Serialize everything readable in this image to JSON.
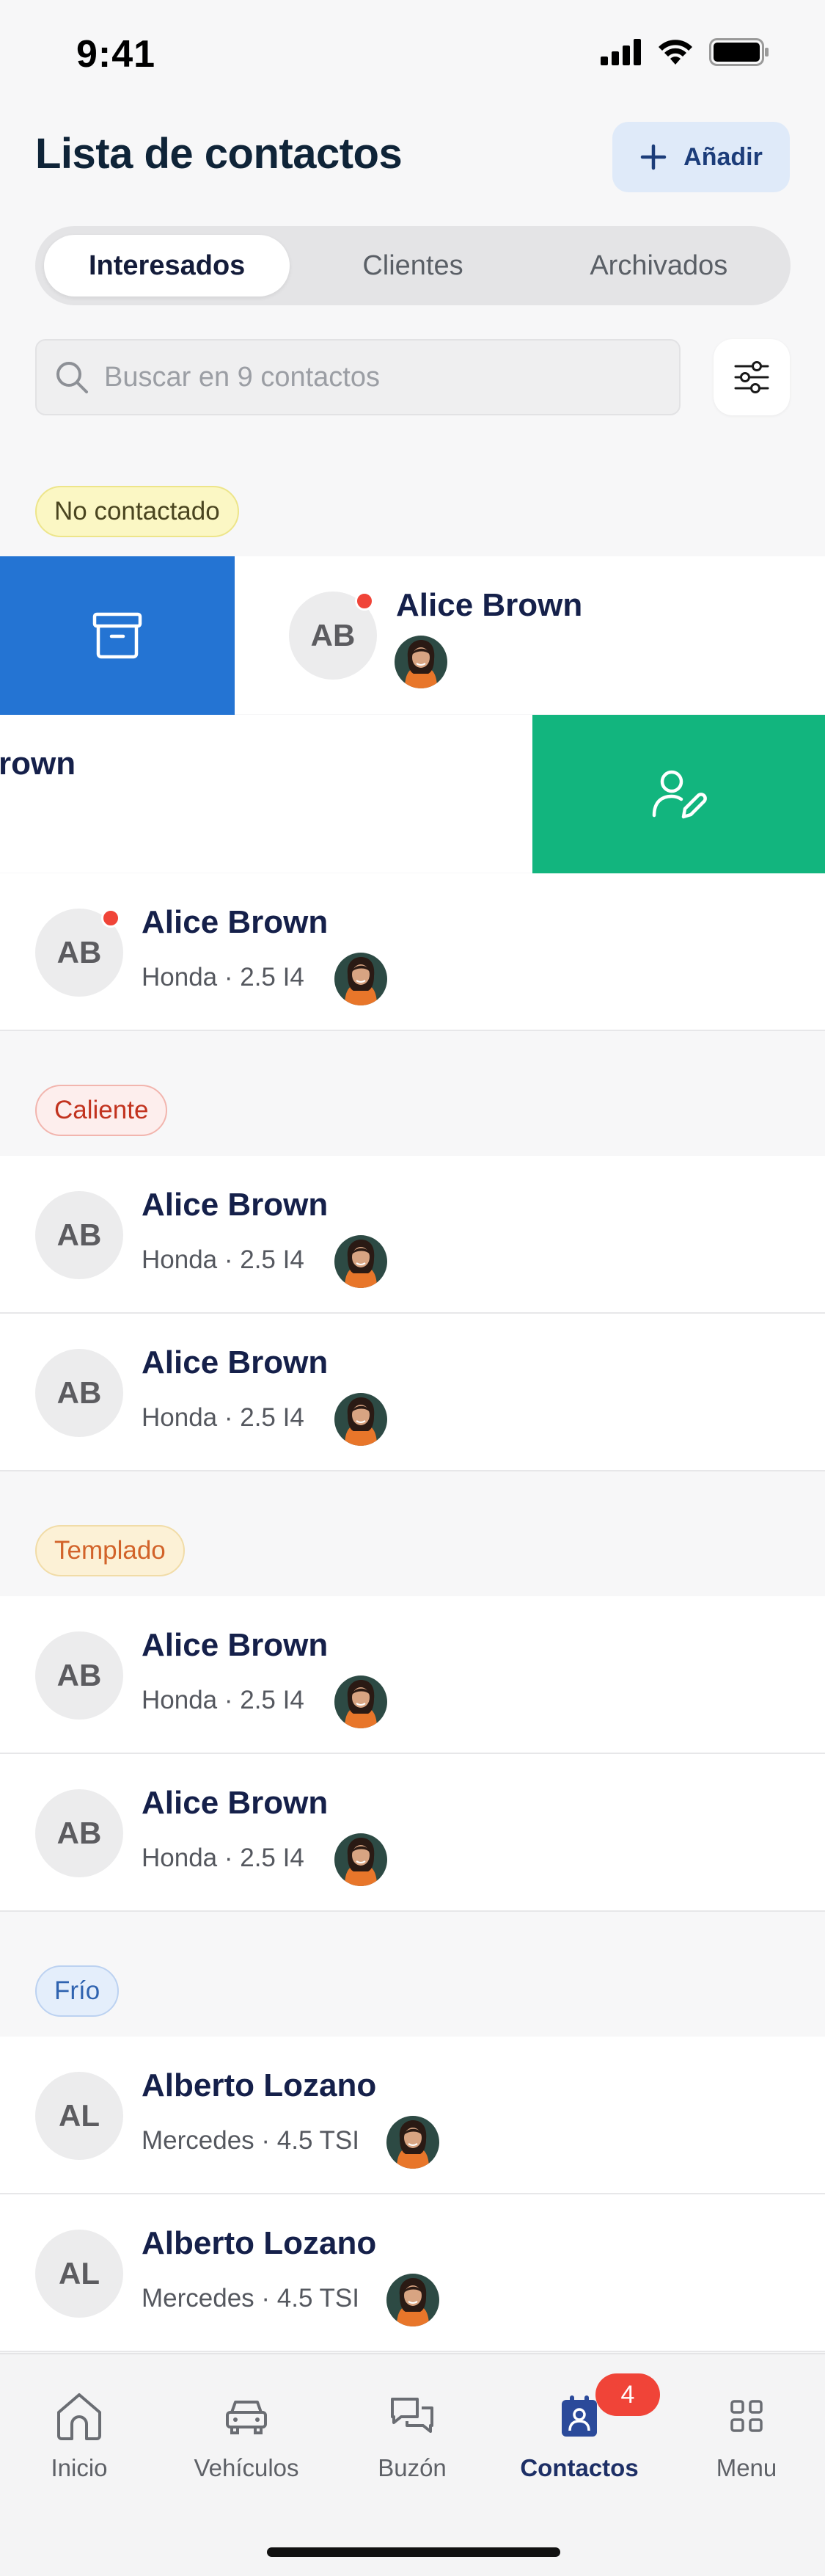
{
  "status_bar": {
    "time": "9:41"
  },
  "header": {
    "title": "Lista de contactos",
    "add_label": "Añadir"
  },
  "tabs": [
    {
      "label": "Interesados",
      "active": true
    },
    {
      "label": "Clientes",
      "active": false
    },
    {
      "label": "Archivados",
      "active": false
    }
  ],
  "search": {
    "placeholder": "Buscar en 9 contactos"
  },
  "sections": {
    "no_contact": "No contactado",
    "hot": "Caliente",
    "warm": "Templado",
    "cold": "Frío"
  },
  "swiped_rows": {
    "left_revealed": {
      "initials": "AB",
      "name": "Alice Brown"
    },
    "right_revealed": {
      "name_fragment": "rown"
    }
  },
  "contacts": [
    {
      "initials": "AB",
      "name": "Alice Brown",
      "detail": "Honda · 2.5 I4",
      "unread": true
    },
    {
      "initials": "AB",
      "name": "Alice Brown",
      "detail": "Honda · 2.5 I4",
      "unread": false
    },
    {
      "initials": "AB",
      "name": "Alice Brown",
      "detail": "Honda · 2.5 I4",
      "unread": false
    },
    {
      "initials": "AB",
      "name": "Alice Brown",
      "detail": "Honda · 2.5 I4",
      "unread": false
    },
    {
      "initials": "AB",
      "name": "Alice Brown",
      "detail": "Honda · 2.5 I4",
      "unread": false
    },
    {
      "initials": "AL",
      "name": "Alberto Lozano",
      "detail": "Mercedes · 4.5 TSI",
      "unread": false
    },
    {
      "initials": "AL",
      "name": "Alberto Lozano",
      "detail": "Mercedes · 4.5 TSI",
      "unread": false
    }
  ],
  "tabbar": {
    "items": [
      {
        "label": "Inicio",
        "icon": "home-icon"
      },
      {
        "label": "Vehículos",
        "icon": "car-icon"
      },
      {
        "label": "Buzón",
        "icon": "chat-icon"
      },
      {
        "label": "Contactos",
        "icon": "contacts-icon",
        "active": true
      },
      {
        "label": "Menu",
        "icon": "grid-icon"
      }
    ],
    "contacts_badge": "4"
  },
  "colors": {
    "archive_action": "#2474d3",
    "assign_action": "#12b57e",
    "unread_dot": "#f04438",
    "brand_navy": "#15204a"
  }
}
